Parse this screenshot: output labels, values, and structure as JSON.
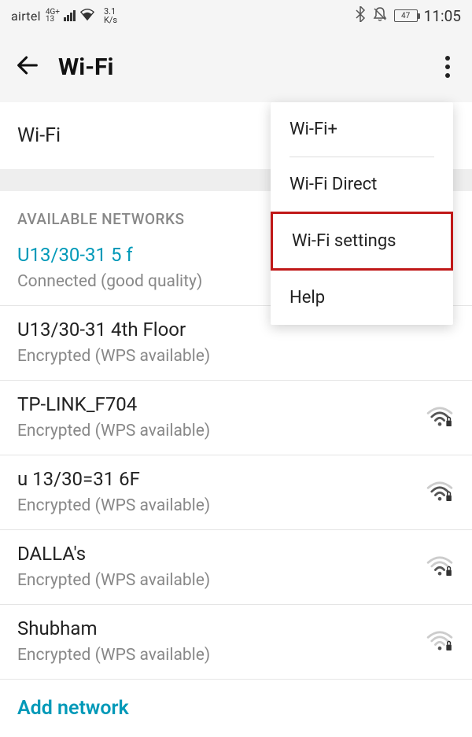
{
  "status": {
    "carrier": "airtel",
    "net_badge_top": "4G+",
    "net_badge_bottom": "13",
    "speed_top": "3.1",
    "speed_bottom": "K/s",
    "battery": "47",
    "time": "11:05"
  },
  "header": {
    "title": "Wi-Fi"
  },
  "wifi_row_label": "Wi-Fi",
  "section_label": "AVAILABLE NETWORKS",
  "networks": [
    {
      "name": "U13/30-31 5 f",
      "sub": "Connected (good quality)",
      "connected": true,
      "show_icon": false
    },
    {
      "name": "U13/30-31 4th Floor",
      "sub": "Encrypted (WPS available)",
      "connected": false,
      "show_icon": false
    },
    {
      "name": "TP-LINK_F704",
      "sub": "Encrypted (WPS available)",
      "connected": false,
      "show_icon": true,
      "strength": 3
    },
    {
      "name": "u 13/30=31 6F",
      "sub": "Encrypted (WPS available)",
      "connected": false,
      "show_icon": true,
      "strength": 3
    },
    {
      "name": "DALLA's",
      "sub": "Encrypted (WPS available)",
      "connected": false,
      "show_icon": true,
      "strength": 2
    },
    {
      "name": "Shubham",
      "sub": "Encrypted (WPS available)",
      "connected": false,
      "show_icon": true,
      "strength": 1
    }
  ],
  "add_network_label": "Add network",
  "menu_items": [
    {
      "label": "Wi-Fi+",
      "highlighted": false
    },
    {
      "label": "Wi-Fi Direct",
      "highlighted": false
    },
    {
      "label": "Wi-Fi settings",
      "highlighted": true
    },
    {
      "label": "Help",
      "highlighted": false
    }
  ]
}
